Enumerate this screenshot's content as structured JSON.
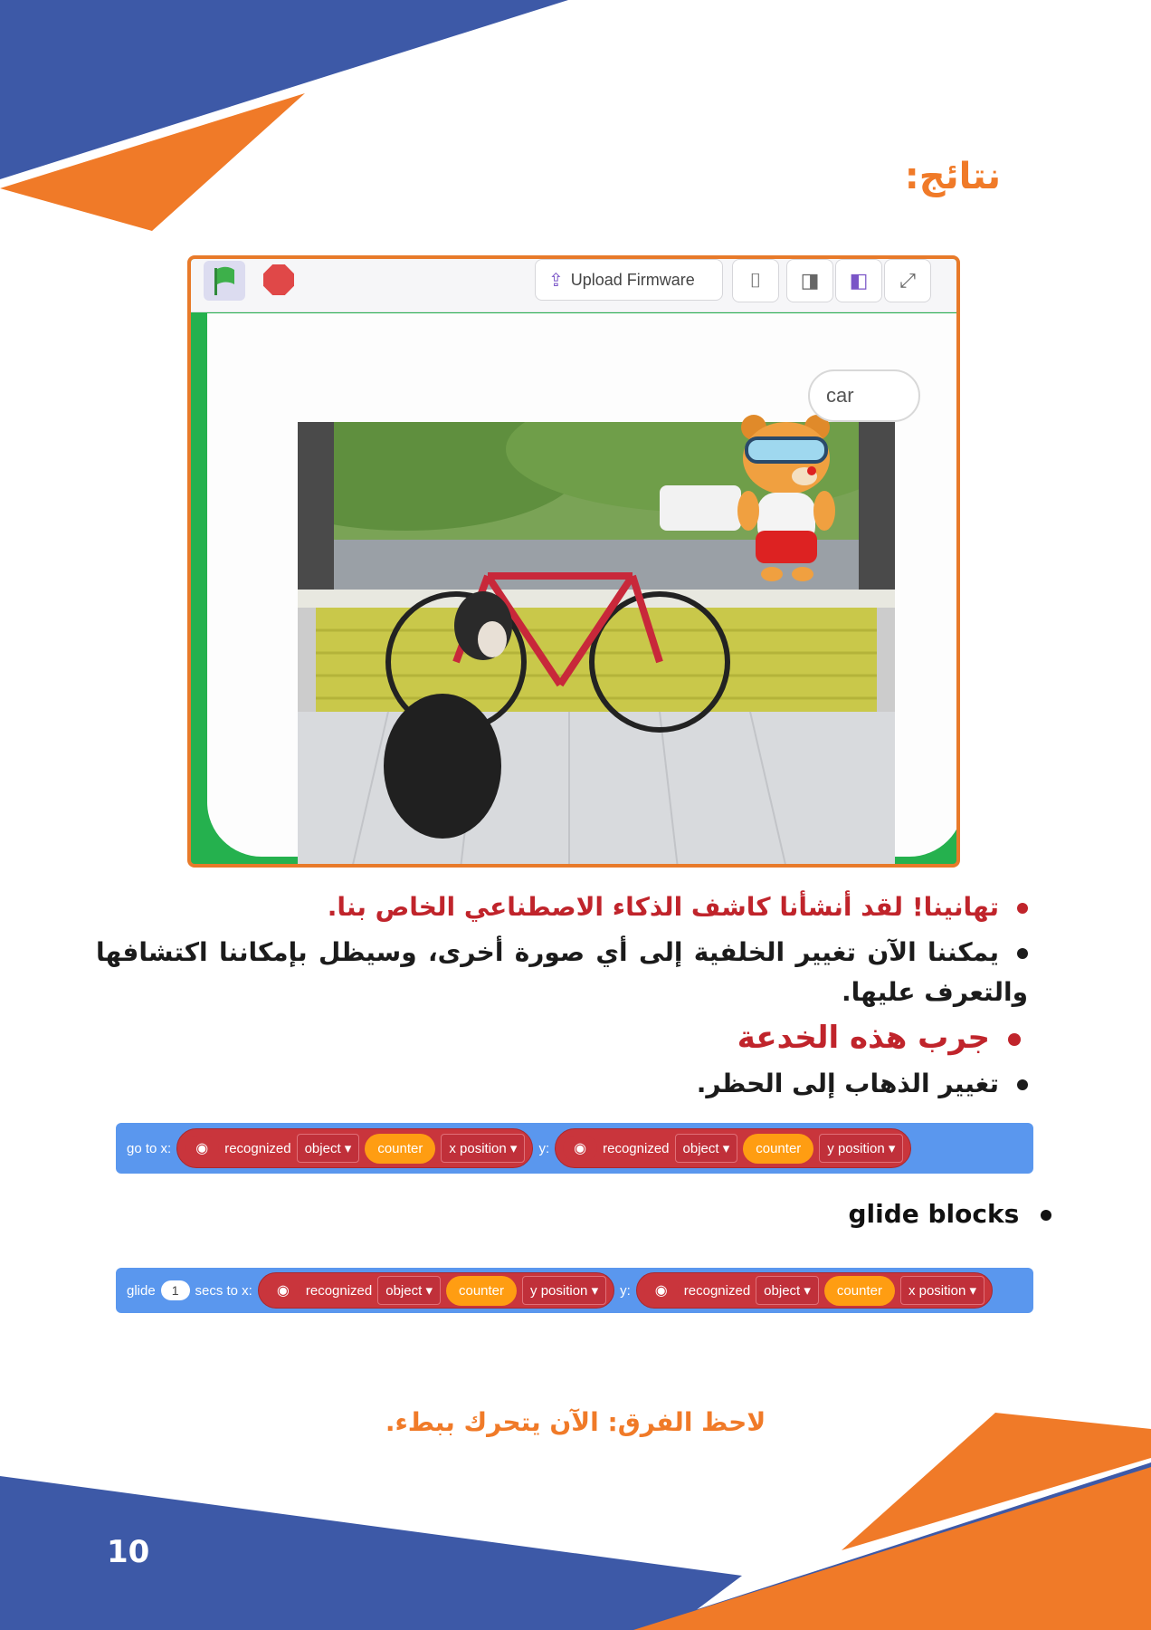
{
  "title": "نتائج:",
  "screenshot": {
    "upload_label": "Upload Firmware",
    "bubble_text": "car"
  },
  "bullets": {
    "b1": "تهانينا! لقد أنشأنا كاشف الذكاء الاصطناعي الخاص بنا.",
    "b2": "يمكننا الآن تغيير الخلفية إلى أي صورة أخرى، وسيظل بإمكاننا اكتشافها والتعرف عليها.",
    "b3": "جرب هذه الخدعة",
    "b4": "تغيير الذهاب إلى الحظر."
  },
  "block1": {
    "label": "go to x:",
    "y_label": "y:",
    "r1": {
      "text": "recognized",
      "dropdown": "object",
      "counter": "counter",
      "attr": "x position"
    },
    "r2": {
      "text": "recognized",
      "dropdown": "object",
      "counter": "counter",
      "attr": "y position"
    }
  },
  "glide_title": "glide blocks",
  "block2": {
    "label": "glide",
    "num": "1",
    "secs": "secs to x:",
    "y_label": "y:",
    "r1": {
      "text": "recognized",
      "dropdown": "object",
      "counter": "counter",
      "attr": "y position"
    },
    "r2": {
      "text": "recognized",
      "dropdown": "object",
      "counter": "counter",
      "attr": "x position"
    }
  },
  "note": "لاحظ الفرق: الآن يتحرك ببطء.",
  "page_number": "10",
  "colors": {
    "blue": "#3d59a7",
    "orange": "#f07a28",
    "red": "#c0242b",
    "green": "#25b14e"
  }
}
